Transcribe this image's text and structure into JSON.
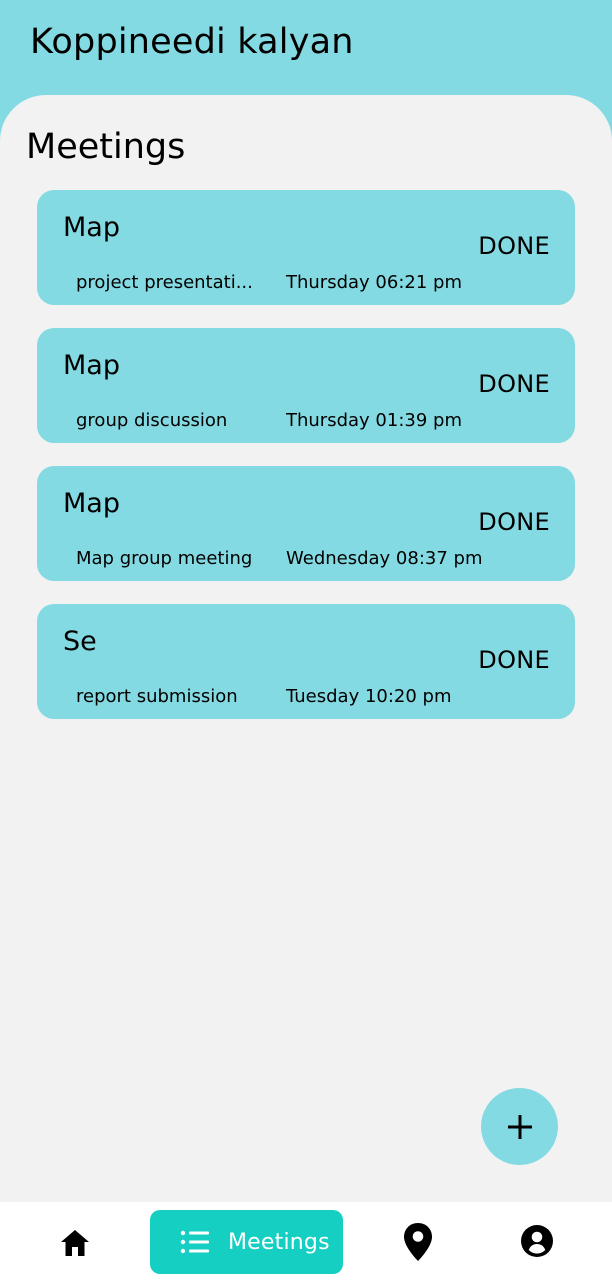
{
  "header": {
    "title": "Koppineedi kalyan"
  },
  "main": {
    "section_title": "Meetings",
    "meetings": [
      {
        "title": "Map",
        "status": "DONE",
        "description": "project presentati...",
        "time": "Thursday 06:21 pm"
      },
      {
        "title": "Map",
        "status": "DONE",
        "description": "group discussion",
        "time": "Thursday 01:39 pm"
      },
      {
        "title": "Map",
        "status": "DONE",
        "description": "Map group meeting",
        "time": "Wednesday 08:37 pm"
      },
      {
        "title": "Se",
        "status": "DONE",
        "description": "report submission",
        "time": "Tuesday 10:20 pm"
      }
    ]
  },
  "fab": {
    "icon": "plus-icon"
  },
  "bottom_nav": {
    "items": [
      {
        "icon": "home-icon"
      },
      {
        "icon": "list-icon",
        "label": "Meetings"
      },
      {
        "icon": "location-pin-icon"
      },
      {
        "icon": "account-circle-icon"
      }
    ]
  },
  "colors": {
    "header_bg": "#84dae2",
    "panel_bg": "#f2f2f2",
    "card_bg": "#84dae2",
    "active_nav_bg": "#15cfc2"
  }
}
